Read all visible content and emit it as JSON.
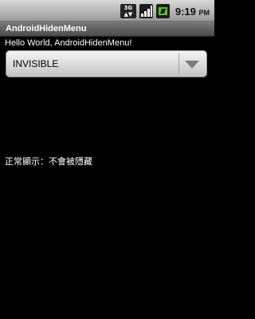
{
  "status_bar": {
    "network_label_top": "3G",
    "network_label_bottom": "▲▼",
    "time": "9:19",
    "time_suffix": "PM",
    "battery_color": "#5bc21d"
  },
  "title_bar": {
    "title": "AndroidHidenMenu"
  },
  "content": {
    "hello_text": "Hello World, AndroidHidenMenu!",
    "spinner": {
      "selected_value": "INVISIBLE",
      "icon": "chevron-down-icon"
    },
    "normal_text": "正常顯示：不會被隱藏"
  }
}
